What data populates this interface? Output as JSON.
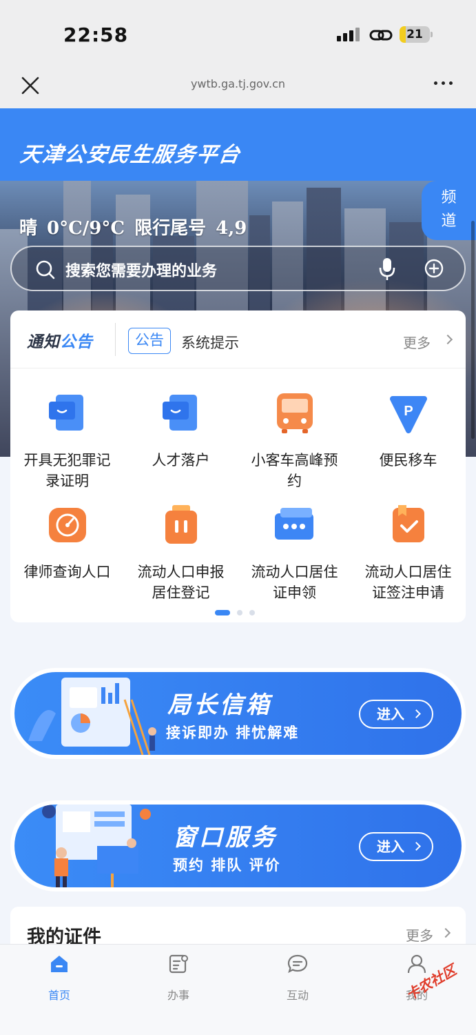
{
  "status_bar": {
    "time": "22:58",
    "battery": "21",
    "battery_level": 0.21
  },
  "browser": {
    "url": "ywtb.ga.tj.gov.cn",
    "close_icon": "close-icon",
    "more_icon": "more-icon"
  },
  "header": {
    "title": "天津公安民生服务平台"
  },
  "hero": {
    "weather": "晴",
    "temperature": "0°C/9°C",
    "restriction_label": "限行尾号",
    "restriction_numbers": "4,9",
    "channel_button": "频道"
  },
  "search": {
    "placeholder": "搜索您需要办理的业务",
    "icons": [
      "search-icon",
      "mic-icon",
      "plus-circle-icon"
    ]
  },
  "notice": {
    "logo_a": "通知",
    "logo_b": "公告",
    "tag": "公告",
    "text": "系统提示",
    "more": "更多"
  },
  "services": [
    {
      "label": "开具无犯罪记录证明",
      "icon": "chat-card-icon"
    },
    {
      "label": "人才落户",
      "icon": "chat-card-icon"
    },
    {
      "label": "小客车高峰预约",
      "icon": "bus-icon"
    },
    {
      "label": "便民移车",
      "icon": "parking-icon"
    },
    {
      "label": "律师查询人口",
      "icon": "gauge-icon"
    },
    {
      "label": "流动人口申报居住登记",
      "icon": "luggage-icon"
    },
    {
      "label": "流动人口居住证申领",
      "icon": "card-dots-icon"
    },
    {
      "label": "流动人口居住证签注申请",
      "icon": "check-doc-icon"
    }
  ],
  "pager": {
    "pages": 3,
    "current": 1
  },
  "banners": [
    {
      "title": "局长信箱",
      "subtitle": "接诉即办 排忧解难",
      "button": "进入"
    },
    {
      "title": "窗口服务",
      "subtitle": "预约 排队 评价",
      "button": "进入"
    }
  ],
  "certificates": {
    "title": "我的证件",
    "more": "更多"
  },
  "tabs": [
    {
      "label": "首页",
      "icon": "home-icon",
      "active": true
    },
    {
      "label": "办事",
      "icon": "task-icon",
      "active": false
    },
    {
      "label": "互动",
      "icon": "message-icon",
      "active": false
    },
    {
      "label": "我的",
      "icon": "user-icon",
      "active": false
    }
  ],
  "watermark": "卡农社区",
  "colors": {
    "primary": "#3a87f4",
    "orange": "#f27a3a",
    "text": "#222222",
    "muted": "#888888"
  }
}
